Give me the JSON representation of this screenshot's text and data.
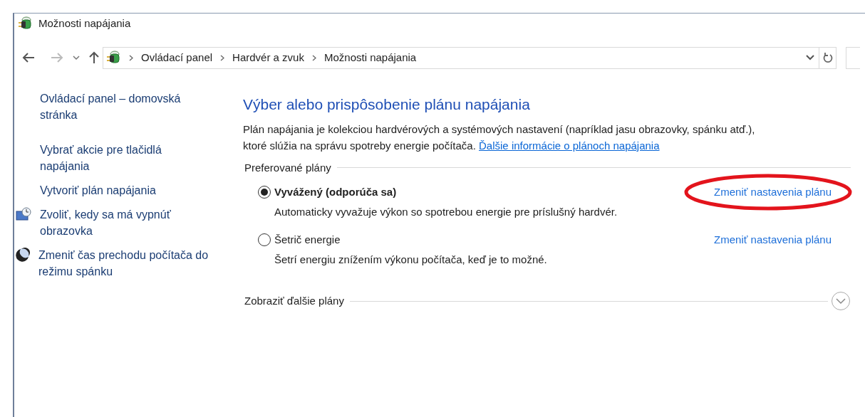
{
  "window": {
    "title": "Možnosti napájania"
  },
  "address_bar": {
    "breadcrumbs": [
      "Ovládací panel",
      "Hardvér a zvuk",
      "Možnosti napájania"
    ]
  },
  "sidebar": {
    "items": [
      {
        "label": "Ovládací panel – domovská stránka",
        "kind": "plain"
      },
      {
        "label": "Vybrať akcie pre tlačidlá napájania",
        "kind": "plain"
      },
      {
        "label": "Vytvoriť plán napájania",
        "kind": "plain"
      },
      {
        "label": "Zvoliť, kedy sa má vypnúť obrazovka",
        "kind": "display"
      },
      {
        "label": "Zmeniť čas prechodu počítača do režimu spánku",
        "kind": "sleep"
      }
    ]
  },
  "main": {
    "heading": "Výber alebo prispôsobenie plánu napájania",
    "description": "Plán napájania je kolekciou hardvérových a systémových nastavení (napríklad jasu obrazovky, spánku atď.), ktoré slúžia na správu spotreby energie počítača.",
    "info_link": "Ďalšie informácie o plánoch napájania",
    "preferred_plans_label": "Preferované plány",
    "plans": [
      {
        "name": "Vyvážený (odporúča sa)",
        "selected": true,
        "description": "Automaticky vyvažuje výkon so spotrebou energie pre príslušný hardvér.",
        "link": "Zmeniť nastavenia plánu",
        "circled": true
      },
      {
        "name": "Šetrič energie",
        "selected": false,
        "description": "Šetrí energiu znížením výkonu počítača, keď je to možné.",
        "link": "Zmeniť nastavenia plánu",
        "circled": false
      }
    ],
    "more_plans_label": "Zobraziť ďalšie plány"
  }
}
